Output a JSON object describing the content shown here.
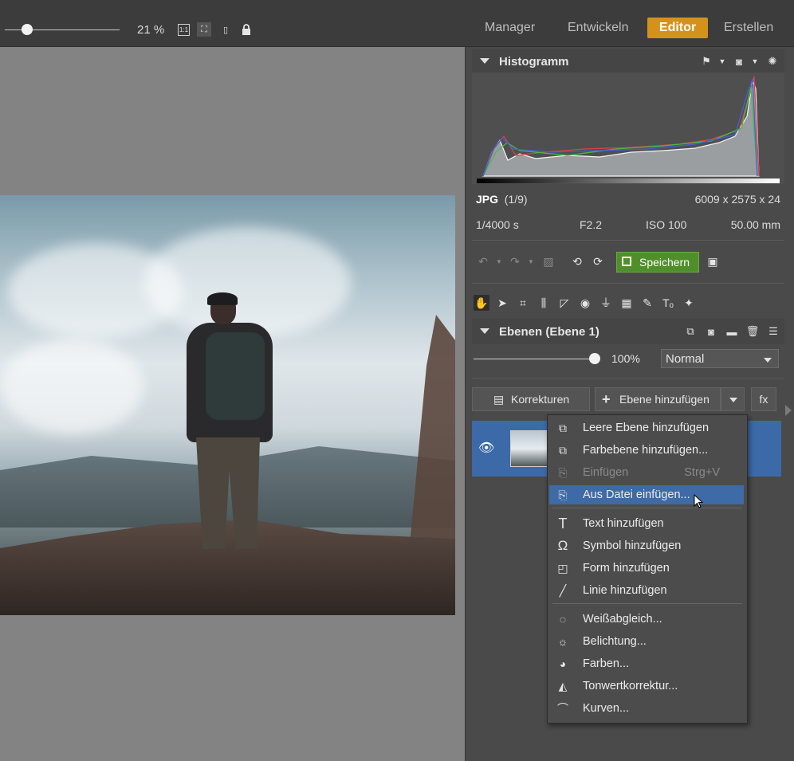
{
  "toolbar": {
    "zoom_value": "21 %",
    "icons": [
      "one-to-one-icon",
      "fit-screen-icon",
      "compare-icon",
      "lock-icon"
    ],
    "one_to_one_text": "1:1"
  },
  "modes": [
    {
      "label": "Manager",
      "active": false
    },
    {
      "label": "Entwickeln",
      "active": false
    },
    {
      "label": "Editor",
      "active": true
    },
    {
      "label": "Erstellen",
      "active": false
    }
  ],
  "histogram": {
    "title": "Histogramm",
    "format": "JPG",
    "index": "(1/9)",
    "dimensions": "6009 x 2575 x 24",
    "shutter": "1/4000 s",
    "aperture": "F2.2",
    "iso": "ISO 100",
    "focal": "50.00 mm"
  },
  "actions": {
    "save_label": "Speichern"
  },
  "layers": {
    "title": "Ebenen (Ebene 1)",
    "opacity": "100%",
    "opacity_fraction": 1.0,
    "blend_mode": "Normal",
    "corrections_label": "Korrekturen",
    "add_layer_label": "Ebene hinzufügen",
    "fx_label": "fx"
  },
  "menu": {
    "items": [
      {
        "label": "Leere Ebene hinzufügen",
        "icon": "empty-layer-icon",
        "glyph": "⧉"
      },
      {
        "label": "Farbebene hinzufügen...",
        "icon": "color-layer-icon",
        "glyph": "⧉"
      },
      {
        "label": "Einfügen",
        "icon": "paste-icon",
        "glyph": "⎘",
        "shortcut": "Strg+V",
        "disabled": true
      },
      {
        "label": "Aus Datei einfügen...",
        "icon": "paste-from-file-icon",
        "glyph": "⎘",
        "highlighted": true
      },
      {
        "label": "Text hinzufügen",
        "icon": "text-icon",
        "glyph": "T"
      },
      {
        "label": "Symbol hinzufügen",
        "icon": "omega-icon",
        "glyph": "Ω"
      },
      {
        "label": "Form hinzufügen",
        "icon": "shape-icon",
        "glyph": "◰"
      },
      {
        "label": "Linie hinzufügen",
        "icon": "line-icon",
        "glyph": "╱"
      },
      {
        "label": "Weißabgleich...",
        "icon": "bulb-icon",
        "glyph": "◌"
      },
      {
        "label": "Belichtung...",
        "icon": "sun-icon",
        "glyph": "☼"
      },
      {
        "label": "Farben...",
        "icon": "palette-icon",
        "glyph": "◕"
      },
      {
        "label": "Tonwertkorrektur...",
        "icon": "levels-icon",
        "glyph": "◭"
      },
      {
        "label": "Kurven...",
        "icon": "curves-icon",
        "glyph": "⌒"
      }
    ]
  }
}
